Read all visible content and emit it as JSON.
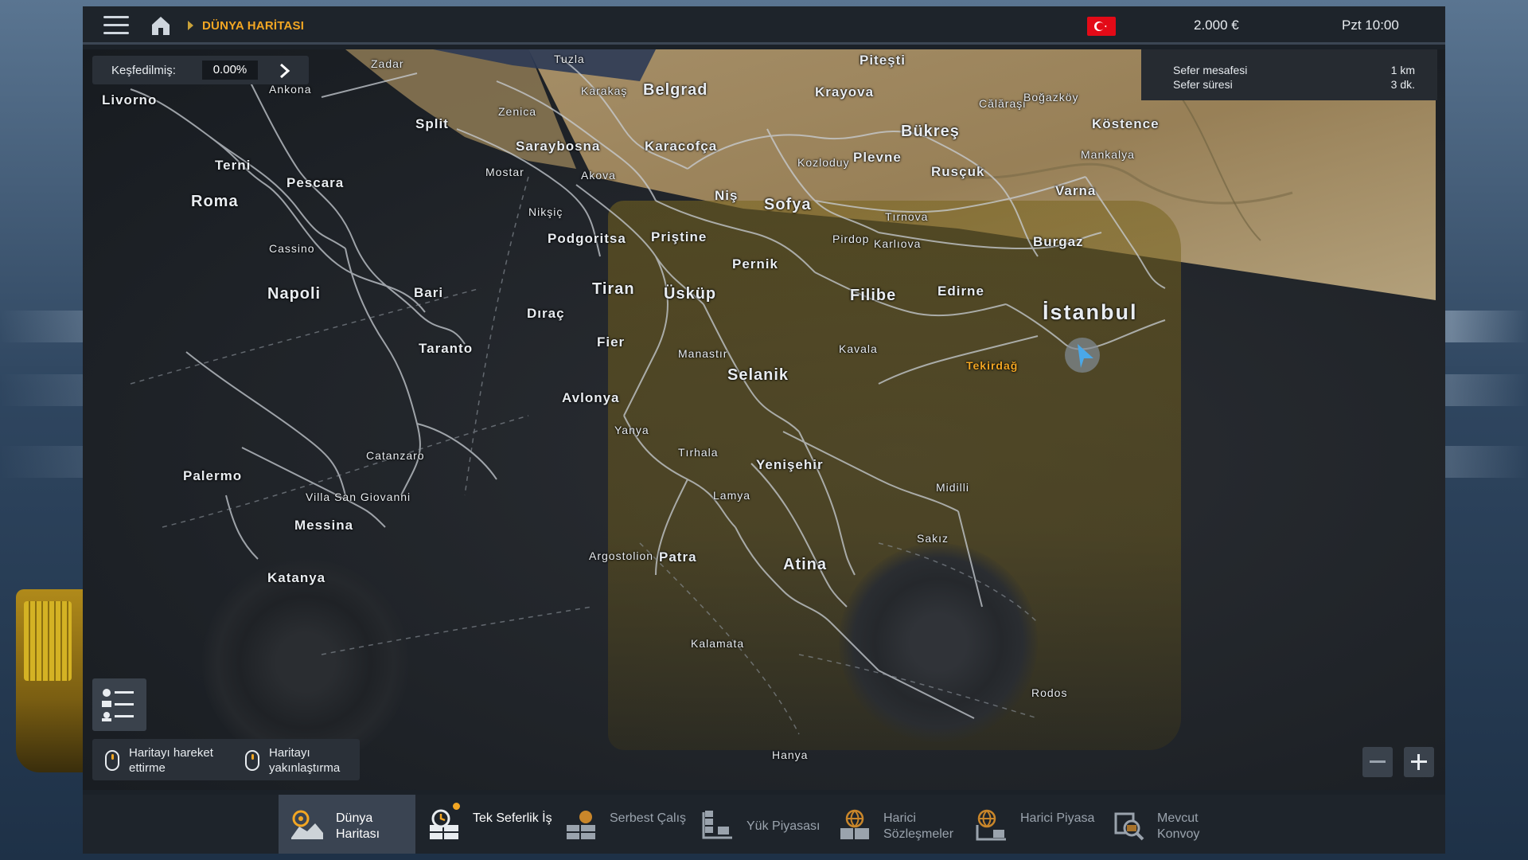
{
  "header": {
    "breadcrumb": "DÜNYA HARİTASI",
    "money": "2.000 €",
    "time": "Pzt 10:00",
    "flag_color": "#e30a17"
  },
  "explore": {
    "label": "Keşfedilmiş:",
    "value": "0.00%"
  },
  "trip": {
    "distance_label": "Sefer mesafesi",
    "distance_value": "1 km",
    "duration_label": "Sefer süresi",
    "duration_value": "3 dk."
  },
  "cities": {
    "zadar": "Zadar",
    "tuzla": "Tuzla",
    "pitesti": "Piteşti",
    "livorno": "Livorno",
    "ankona": "Ankona",
    "karakas": "Karakaş",
    "belgrad": "Belgrad",
    "krayova": "Krayova",
    "calarasi": "Călăraşi",
    "bogazkoy": "Boğazköy",
    "zenica": "Zenica",
    "split": "Split",
    "bukres": "Bükreş",
    "kostence": "Köstence",
    "saraybosna": "Saraybosna",
    "karacofca": "Karacofça",
    "kozloduy": "Kozloduy",
    "plevne": "Plevne",
    "mankalya": "Mankalya",
    "terni": "Terni",
    "mostar": "Mostar",
    "akova": "Akova",
    "rusçuk": "Rusçuk",
    "pescara": "Pescara",
    "varna": "Varna",
    "roma": "Roma",
    "nis": "Niş",
    "sofya": "Sofya",
    "niksic": "Nikşiç",
    "tirnova": "Tırnova",
    "podgoritsa": "Podgoritsa",
    "pristine": "Priştine",
    "pirdop": "Pirdop",
    "karlova": "Karlıova",
    "burgaz": "Burgaz",
    "cassino": "Cassino",
    "pernik": "Pernik",
    "napoli": "Napoli",
    "bari": "Bari",
    "tiran": "Tiran",
    "uskup": "Üsküp",
    "edirne": "Edirne",
    "filibe": "Filibe",
    "istanbul": "İstanbul",
    "drac": "Dıraç",
    "fier": "Fier",
    "manastir": "Manastır",
    "kavala": "Kavala",
    "taranto": "Taranto",
    "tekirdag": "Tekirdağ",
    "selanik": "Selanik",
    "avlonya": "Avlonya",
    "yanya": "Yanya",
    "catanzaro": "Catanzaro",
    "tirhala": "Tırhala",
    "yenisehir": "Yenişehir",
    "palermo": "Palermo",
    "midilli": "Midilli",
    "lamya": "Lamya",
    "villasg": "Villa San Giovanni",
    "messina": "Messina",
    "sakiz": "Sakız",
    "argostoli": "Argostolion",
    "patra": "Patra",
    "atina": "Atina",
    "katanya": "Katanya",
    "kalamata": "Kalamata",
    "rodos": "Rodos",
    "hanya": "Hanya"
  },
  "hints": {
    "move": "Haritayı hareket ettirme",
    "zoom": "Haritayı yakınlaştırma"
  },
  "nav": [
    {
      "label": "Dünya Haritası",
      "icon": "world-map-icon"
    },
    {
      "label": "Tek Seferlik İş",
      "icon": "quick-job-icon"
    },
    {
      "label": "Serbest Çalış",
      "icon": "freight-market-icon"
    },
    {
      "label": "Yük Piyasası",
      "icon": "cargo-market-icon"
    },
    {
      "label": "Harici Sözleşmeler",
      "icon": "external-contracts-icon"
    },
    {
      "label": "Harici Piyasa",
      "icon": "external-market-icon"
    },
    {
      "label": "Mevcut Konvoy",
      "icon": "convoy-icon"
    }
  ],
  "colors": {
    "accent": "#f2a623",
    "bar": "#1e242b",
    "active_tab": "#3a4452"
  }
}
